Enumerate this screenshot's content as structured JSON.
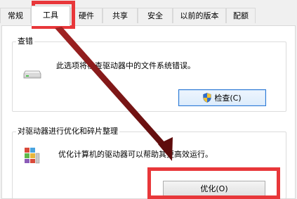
{
  "tabs": [
    {
      "label": "常规"
    },
    {
      "label": "工具"
    },
    {
      "label": "硬件"
    },
    {
      "label": "共享"
    },
    {
      "label": "安全"
    },
    {
      "label": "以前的版本"
    },
    {
      "label": "配额"
    }
  ],
  "active_tab": "工具",
  "error_check": {
    "title": "查错",
    "description": "此选项将检查驱动器中的文件系统错误。",
    "button_label": "检查(C)",
    "icon": "drive-icon",
    "button_icon": "shield-icon"
  },
  "optimize": {
    "title": "对驱动器进行优化和碎片整理",
    "description": "优化计算机的驱动器可以帮助其更高效运行。",
    "button_label": "优化(O)",
    "icon": "defrag-icon"
  },
  "annotation": {
    "highlight_color": "#e8373a",
    "arrow_color": "#7a1212"
  }
}
